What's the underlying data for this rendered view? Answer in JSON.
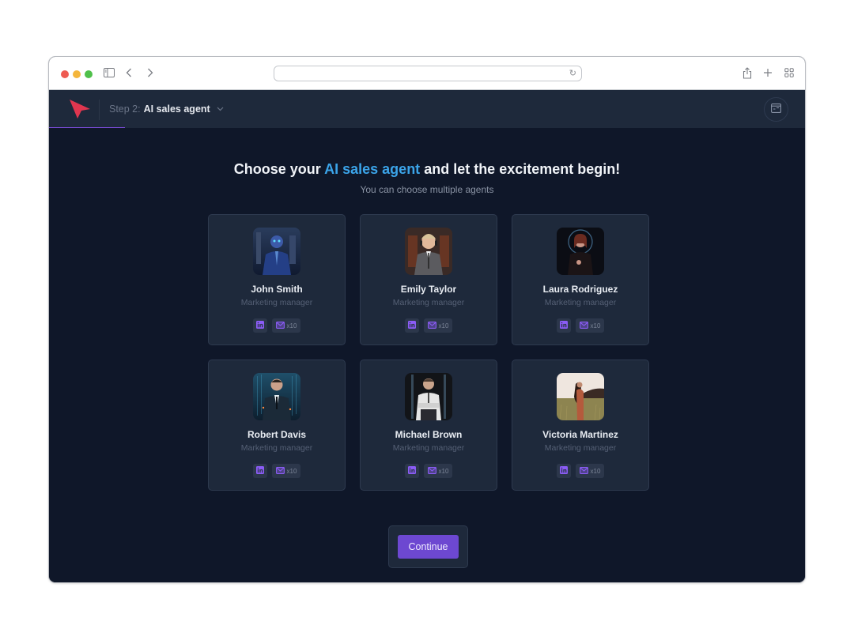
{
  "browser": {
    "url": "",
    "icons": [
      "sidebar-icon",
      "back-icon",
      "forward-icon",
      "reload-icon",
      "share-icon",
      "new-tab-icon",
      "tab-overview-icon"
    ]
  },
  "appbar": {
    "step_prefix": "Step 2:",
    "step_name": "AI sales agent",
    "chevron": "⌄",
    "progress_fraction": 0.1,
    "brand_color": "#e0364f",
    "accent_color": "#7c4ddb"
  },
  "main": {
    "title_before": "Choose your ",
    "title_accent": "AI sales agent",
    "title_after": " and let the excitement begin!",
    "subtitle": "You can choose multiple agents",
    "accent_color": "#3ba4e9"
  },
  "agents": [
    {
      "name": "John Smith",
      "role": "Marketing manager",
      "email_count": "x10",
      "avatar_theme": "robot-blue-city"
    },
    {
      "name": "Emily Taylor",
      "role": "Marketing manager",
      "email_count": "x10",
      "avatar_theme": "headset-warm"
    },
    {
      "name": "Laura Rodriguez",
      "role": "Marketing manager",
      "email_count": "x10",
      "avatar_theme": "dark-halo"
    },
    {
      "name": "Robert Davis",
      "role": "Marketing manager",
      "email_count": "x10",
      "avatar_theme": "suit-cyan"
    },
    {
      "name": "Michael Brown",
      "role": "Marketing manager",
      "email_count": "x10",
      "avatar_theme": "white-shirt-dark"
    },
    {
      "name": "Victoria Martinez",
      "role": "Marketing manager",
      "email_count": "x10",
      "avatar_theme": "field-outdoor"
    }
  ],
  "footer": {
    "continue_label": "Continue",
    "button_color": "#6d48d1"
  }
}
